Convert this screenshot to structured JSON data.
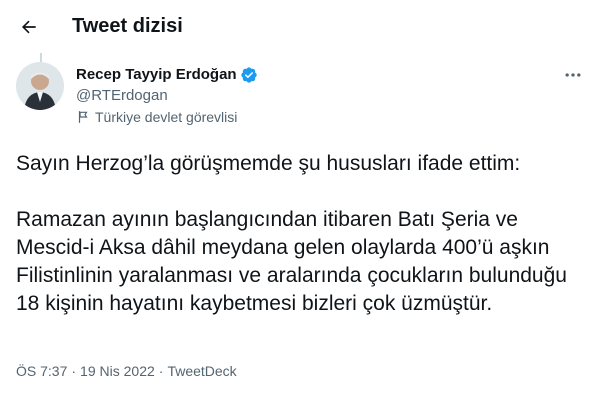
{
  "header": {
    "title": "Tweet dizisi"
  },
  "author": {
    "name": "Recep Tayyip Erdoğan",
    "handle": "@RTErdogan",
    "label": "Türkiye devlet görevlisi"
  },
  "tweet": {
    "text": "Sayın Herzog’la görüşmemde şu hususları ifade ettim:\n\nRamazan ayının başlangıcından itibaren Batı Şeria ve Mescid-i Aksa dâhil meydana gelen olaylarda 400’ü aşkın Filistinlinin yaralanması ve aralarında çocukların bulunduğu 18 kişinin hayatını kaybetmesi bizleri çok üzmüştür."
  },
  "meta": {
    "time": "ÖS 7:37",
    "separator1": "·",
    "date": "19 Nis 2022",
    "separator2": "·",
    "source": "TweetDeck"
  },
  "colors": {
    "verified": "#1d9bf0",
    "secondary_text": "#536471",
    "primary_text": "#0f1419"
  },
  "icons": {
    "back": "arrow-left-icon",
    "verified": "verified-badge-icon",
    "label": "flag-icon",
    "more": "more-horizontal-icon"
  }
}
